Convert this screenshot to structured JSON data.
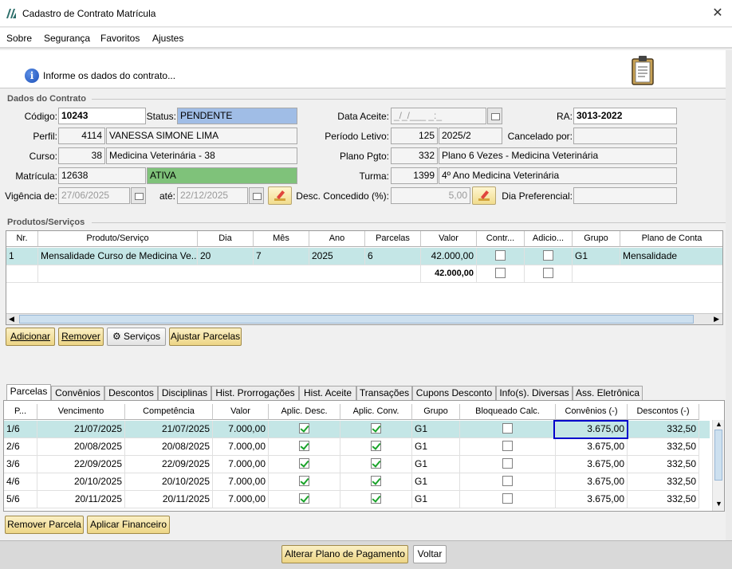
{
  "window": {
    "title": "Cadastro de Contrato Matrícula",
    "close_glyph": "✕"
  },
  "menu": [
    "Sobre",
    "Segurança",
    "Favoritos",
    "Ajustes"
  ],
  "info": {
    "text": "Informe os dados do contrato..."
  },
  "dados": {
    "group_title": "Dados do Contrato",
    "codigo_label": "Código:",
    "codigo": "10243",
    "status_label": "Status:",
    "status": "PENDENTE",
    "data_aceite_label": "Data Aceite:",
    "data_aceite": "_/_/___ _:_",
    "ra_label": "RA:",
    "ra": "3013-2022",
    "perfil_label": "Perfil:",
    "perfil_id": "4114",
    "perfil_nome": "VANESSA SIMONE LIMA",
    "periodo_label": "Período Letivo:",
    "periodo_id": "125",
    "periodo_nome": "2025/2",
    "cancelado_label": "Cancelado por:",
    "cancelado": "",
    "curso_label": "Curso:",
    "curso_id": "38",
    "curso_nome": "Medicina Veterinária - 38",
    "plano_label": "Plano Pgto:",
    "plano_id": "332",
    "plano_nome": "Plano 6 Vezes - Medicina Veterinária",
    "matricula_label": "Matrícula:",
    "matricula": "12638",
    "matricula_status": "ATIVA",
    "turma_label": "Turma:",
    "turma_id": "1399",
    "turma_nome": "4º Ano Medicina Veterinária",
    "vigencia_label": "Vigência de:",
    "vigencia_de": "27/06/2025",
    "ate_label": "até:",
    "vigencia_ate": "22/12/2025",
    "desc_label": "Desc. Concedido (%):",
    "desc_value": "5,00",
    "dia_pref_label": "Dia Preferencial:",
    "dia_pref": ""
  },
  "produtos": {
    "group_title": "Produtos/Serviços",
    "headers": [
      "Nr.",
      "Produto/Serviço",
      "Dia",
      "Mês",
      "Ano",
      "Parcelas",
      "Valor",
      "Contr...",
      "Adicio...",
      "Grupo",
      "Plano de Conta"
    ],
    "rows": [
      {
        "nr": "1",
        "produto": "Mensalidade Curso de Medicina Ve...",
        "dia": "20",
        "mes": "7",
        "ano": "2025",
        "parcelas": "6",
        "valor": "42.000,00",
        "contr": false,
        "adic": false,
        "grupo": "G1",
        "plano": "Mensalidade"
      }
    ],
    "total": "42.000,00",
    "buttons": {
      "adicionar": "Adicionar",
      "remover": "Remover",
      "servicos": "Serviços",
      "ajustar": "Ajustar Parcelas"
    }
  },
  "tabs": [
    "Parcelas",
    "Convênios",
    "Descontos",
    "Disciplinas",
    "Hist. Prorrogações",
    "Hist. Aceite",
    "Transações",
    "Cupons Desconto",
    "Info(s). Diversas",
    "Ass. Eletrônica"
  ],
  "parcelas": {
    "headers": [
      "P...",
      "Vencimento",
      "Competência",
      "Valor",
      "Aplic. Desc.",
      "Aplic. Conv.",
      "Grupo",
      "Bloqueado Calc.",
      "Convênios (-)",
      "Descontos (-)"
    ],
    "rows": [
      {
        "p": "1/6",
        "venc": "21/07/2025",
        "comp": "21/07/2025",
        "valor": "7.000,00",
        "desc": true,
        "conv": true,
        "grupo": "G1",
        "bloq": false,
        "convenios": "3.675,00",
        "descontos": "332,50"
      },
      {
        "p": "2/6",
        "venc": "20/08/2025",
        "comp": "20/08/2025",
        "valor": "7.000,00",
        "desc": true,
        "conv": true,
        "grupo": "G1",
        "bloq": false,
        "convenios": "3.675,00",
        "descontos": "332,50"
      },
      {
        "p": "3/6",
        "venc": "22/09/2025",
        "comp": "22/09/2025",
        "valor": "7.000,00",
        "desc": true,
        "conv": true,
        "grupo": "G1",
        "bloq": false,
        "convenios": "3.675,00",
        "descontos": "332,50"
      },
      {
        "p": "4/6",
        "venc": "20/10/2025",
        "comp": "20/10/2025",
        "valor": "7.000,00",
        "desc": true,
        "conv": true,
        "grupo": "G1",
        "bloq": false,
        "convenios": "3.675,00",
        "descontos": "332,50"
      },
      {
        "p": "5/6",
        "venc": "20/11/2025",
        "comp": "20/11/2025",
        "valor": "7.000,00",
        "desc": true,
        "conv": true,
        "grupo": "G1",
        "bloq": false,
        "convenios": "3.675,00",
        "descontos": "332,50"
      }
    ],
    "buttons": {
      "remover": "Remover Parcela",
      "aplicar": "Aplicar Financeiro"
    }
  },
  "footer": {
    "alterar": "Alterar Plano de Pagamento",
    "voltar": "Voltar"
  },
  "colors": {
    "status_bg": "#a0bde6",
    "ativa_bg": "#7fc27a",
    "selected_row": "#c4e6e6",
    "highlight_border": "#0000cc"
  }
}
